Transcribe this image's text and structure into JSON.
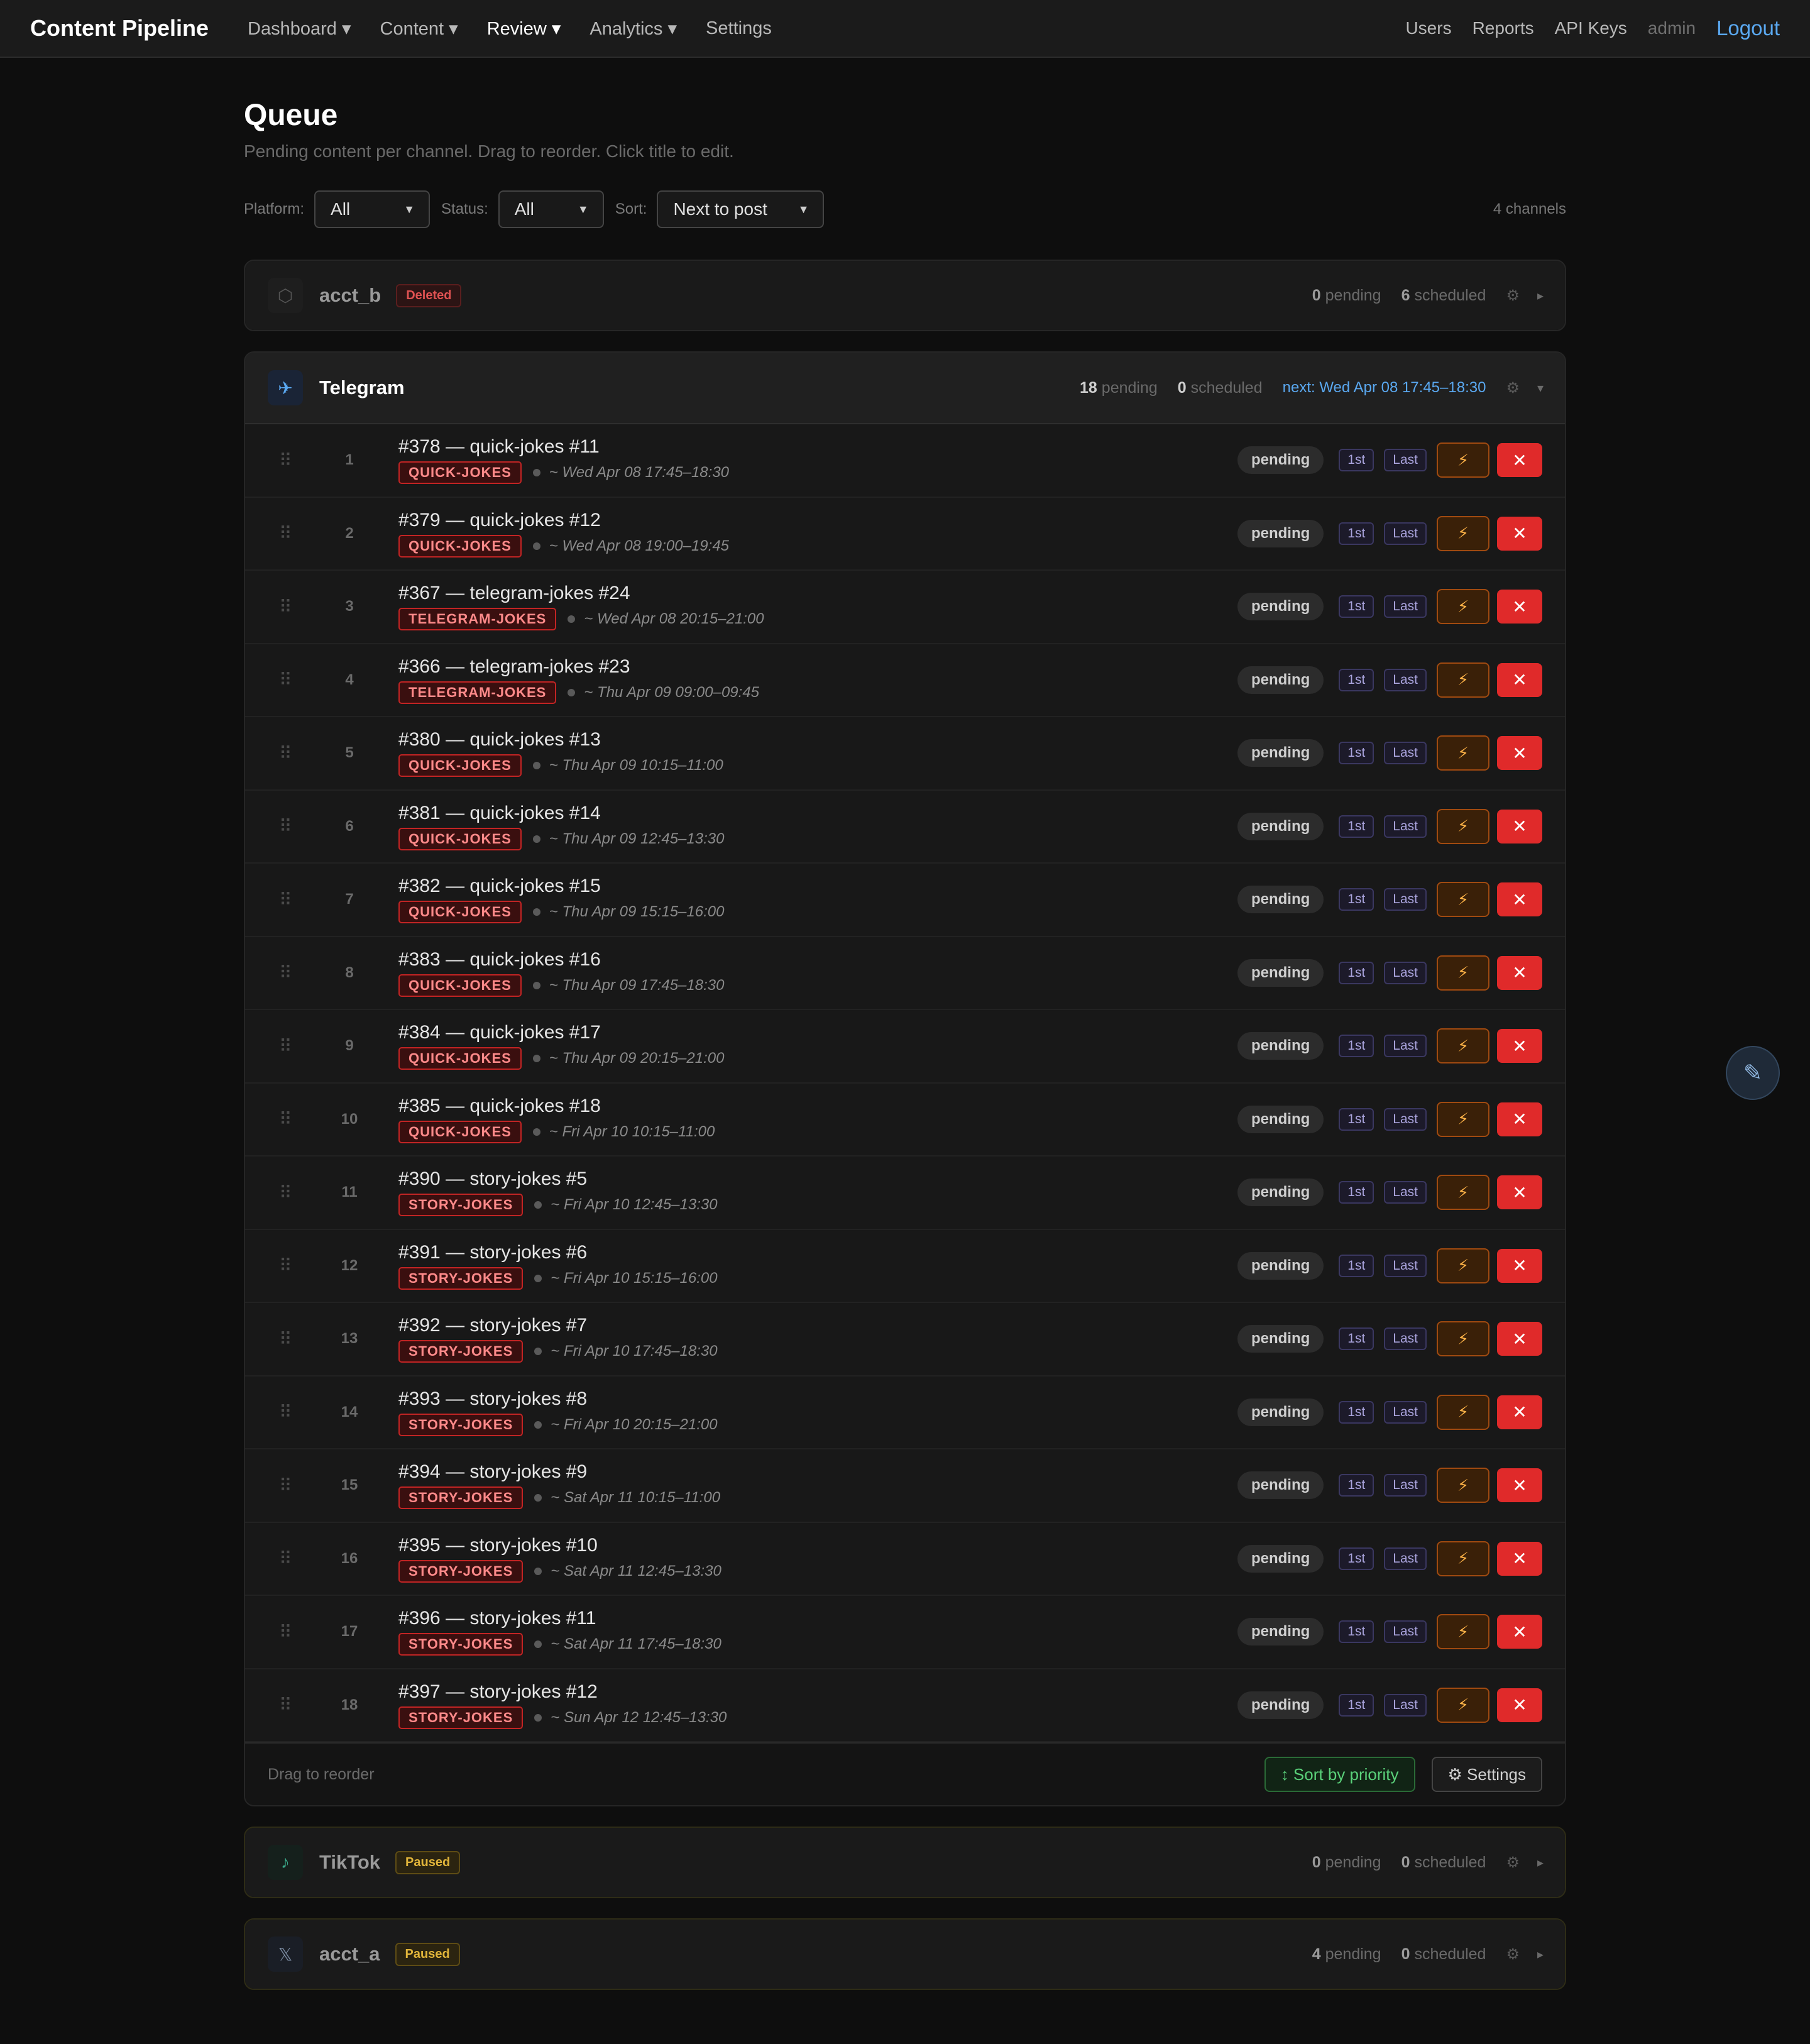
{
  "nav": {
    "brand": "Content Pipeline",
    "links": [
      {
        "label": "Dashboard ▾"
      },
      {
        "label": "Content ▾"
      },
      {
        "label": "Review ▾"
      },
      {
        "label": "Analytics ▾"
      },
      {
        "label": "Settings"
      }
    ],
    "right": {
      "users": "Users",
      "reports": "Reports",
      "api_keys": "API Keys",
      "user": "admin",
      "logout": "Logout"
    }
  },
  "page": {
    "title": "Queue",
    "subtitle": "Pending content per channel. Drag to reorder. Click title to edit."
  },
  "filters": {
    "platform_label": "Platform:",
    "platform_value": "All",
    "status_label": "Status:",
    "status_value": "All",
    "sort_label": "Sort:",
    "sort_value": "Next to post",
    "channel_count": "4 channels"
  },
  "colors": {
    "accent_blue": "#5aa8f0",
    "danger_red": "#e02a2a",
    "tag_red": "#c22424",
    "bolt_orange": "#ffb347",
    "sort_green": "#5ad17a",
    "paused_yellow": "#e0b43a"
  },
  "channels": {
    "acct_b": {
      "icon": "generic-account-icon",
      "glyph": "⬡",
      "name": "acct_b",
      "badge": "Deleted",
      "pending": "0",
      "pending_label": "pending",
      "scheduled": "6",
      "scheduled_label": "scheduled"
    },
    "telegram": {
      "icon": "telegram-icon",
      "glyph": "✈",
      "name": "Telegram",
      "pending": "18",
      "pending_label": "pending",
      "scheduled": "0",
      "scheduled_label": "scheduled",
      "next": "next: Wed Apr 08 17:45–18:30",
      "footer_hint": "Drag to reorder",
      "sort_button": "↕ Sort by priority",
      "settings_button": "⚙ Settings",
      "row_status": "pending",
      "first_label": "1st",
      "last_label": "Last",
      "items": [
        {
          "pos": "1",
          "title": "#378 — quick-jokes #11",
          "tag": "QUICK-JOKES",
          "sched": "~ Wed Apr 08 17:45–18:30"
        },
        {
          "pos": "2",
          "title": "#379 — quick-jokes #12",
          "tag": "QUICK-JOKES",
          "sched": "~ Wed Apr 08 19:00–19:45"
        },
        {
          "pos": "3",
          "title": "#367 — telegram-jokes #24",
          "tag": "TELEGRAM-JOKES",
          "sched": "~ Wed Apr 08 20:15–21:00"
        },
        {
          "pos": "4",
          "title": "#366 — telegram-jokes #23",
          "tag": "TELEGRAM-JOKES",
          "sched": "~ Thu Apr 09 09:00–09:45"
        },
        {
          "pos": "5",
          "title": "#380 — quick-jokes #13",
          "tag": "QUICK-JOKES",
          "sched": "~ Thu Apr 09 10:15–11:00"
        },
        {
          "pos": "6",
          "title": "#381 — quick-jokes #14",
          "tag": "QUICK-JOKES",
          "sched": "~ Thu Apr 09 12:45–13:30"
        },
        {
          "pos": "7",
          "title": "#382 — quick-jokes #15",
          "tag": "QUICK-JOKES",
          "sched": "~ Thu Apr 09 15:15–16:00"
        },
        {
          "pos": "8",
          "title": "#383 — quick-jokes #16",
          "tag": "QUICK-JOKES",
          "sched": "~ Thu Apr 09 17:45–18:30"
        },
        {
          "pos": "9",
          "title": "#384 — quick-jokes #17",
          "tag": "QUICK-JOKES",
          "sched": "~ Thu Apr 09 20:15–21:00"
        },
        {
          "pos": "10",
          "title": "#385 — quick-jokes #18",
          "tag": "QUICK-JOKES",
          "sched": "~ Fri Apr 10 10:15–11:00"
        },
        {
          "pos": "11",
          "title": "#390 — story-jokes #5",
          "tag": "STORY-JOKES",
          "sched": "~ Fri Apr 10 12:45–13:30"
        },
        {
          "pos": "12",
          "title": "#391 — story-jokes #6",
          "tag": "STORY-JOKES",
          "sched": "~ Fri Apr 10 15:15–16:00"
        },
        {
          "pos": "13",
          "title": "#392 — story-jokes #7",
          "tag": "STORY-JOKES",
          "sched": "~ Fri Apr 10 17:45–18:30"
        },
        {
          "pos": "14",
          "title": "#393 — story-jokes #8",
          "tag": "STORY-JOKES",
          "sched": "~ Fri Apr 10 20:15–21:00"
        },
        {
          "pos": "15",
          "title": "#394 — story-jokes #9",
          "tag": "STORY-JOKES",
          "sched": "~ Sat Apr 11 10:15–11:00"
        },
        {
          "pos": "16",
          "title": "#395 — story-jokes #10",
          "tag": "STORY-JOKES",
          "sched": "~ Sat Apr 11 12:45–13:30"
        },
        {
          "pos": "17",
          "title": "#396 — story-jokes #11",
          "tag": "STORY-JOKES",
          "sched": "~ Sat Apr 11 17:45–18:30"
        },
        {
          "pos": "18",
          "title": "#397 — story-jokes #12",
          "tag": "STORY-JOKES",
          "sched": "~ Sun Apr 12 12:45–13:30"
        }
      ]
    },
    "tiktok": {
      "icon": "tiktok-icon",
      "glyph": "♪",
      "name": "TikTok",
      "badge": "Paused",
      "pending": "0",
      "pending_label": "pending",
      "scheduled": "0",
      "scheduled_label": "scheduled"
    },
    "acct_a": {
      "icon": "x-twitter-icon",
      "glyph": "𝕏",
      "name": "acct_a",
      "badge": "Paused",
      "pending": "4",
      "pending_label": "pending",
      "scheduled": "0",
      "scheduled_label": "scheduled"
    }
  },
  "fab": {
    "icon": "edit-pencil-icon",
    "glyph": "✎"
  }
}
